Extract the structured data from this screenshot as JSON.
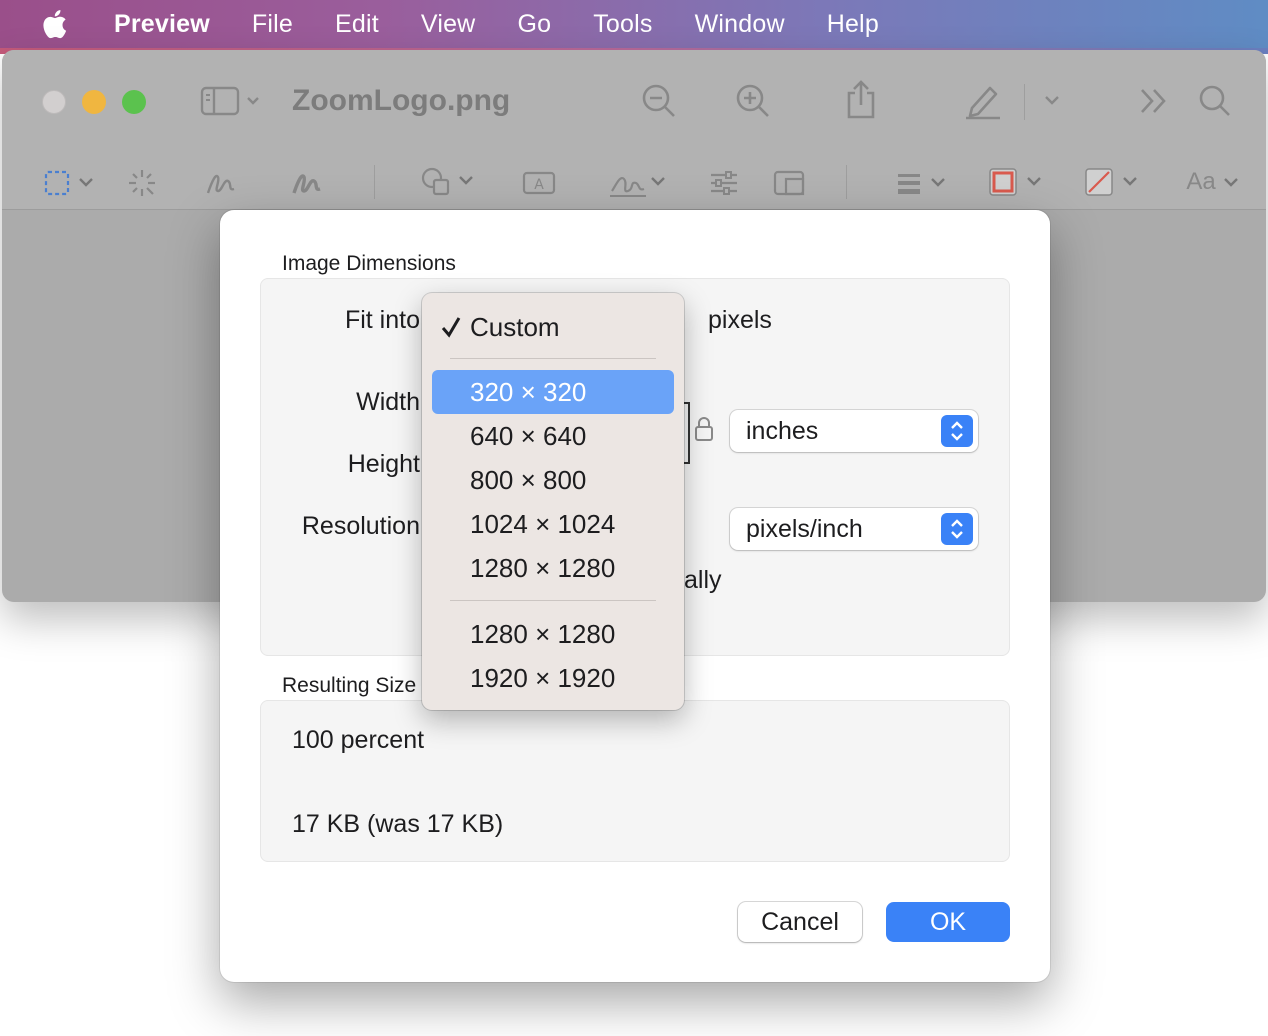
{
  "menubar": {
    "app": "Preview",
    "items": [
      "File",
      "Edit",
      "View",
      "Go",
      "Tools",
      "Window",
      "Help"
    ]
  },
  "window": {
    "title": "ZoomLogo.png",
    "font_button": "Aa"
  },
  "dialog": {
    "image_dimensions_label": "Image Dimensions",
    "fit_into_label": "Fit into",
    "fit_into_unit": "pixels",
    "width_label": "Width",
    "height_label": "Height",
    "resolution_label": "Resolution",
    "size_unit": "inches",
    "resolution_unit": "pixels/inch",
    "resample_partial": "ally",
    "resulting_size_label": "Resulting Size",
    "percent": "100 percent",
    "file_size": "17 KB (was 17 KB)",
    "cancel": "Cancel",
    "ok": "OK"
  },
  "dropdown": {
    "checked": "Custom",
    "group1": [
      "320 × 320",
      "640 × 640",
      "800 × 800",
      "1024 × 1024",
      "1280 × 1280"
    ],
    "group2": [
      "1280 × 1280",
      "1920 × 1920"
    ],
    "highlighted": "320 × 320"
  },
  "colors": {
    "accent": "#3a82f7",
    "highlight": "#6aa3f8",
    "menu_bg": "#ece6e3"
  }
}
